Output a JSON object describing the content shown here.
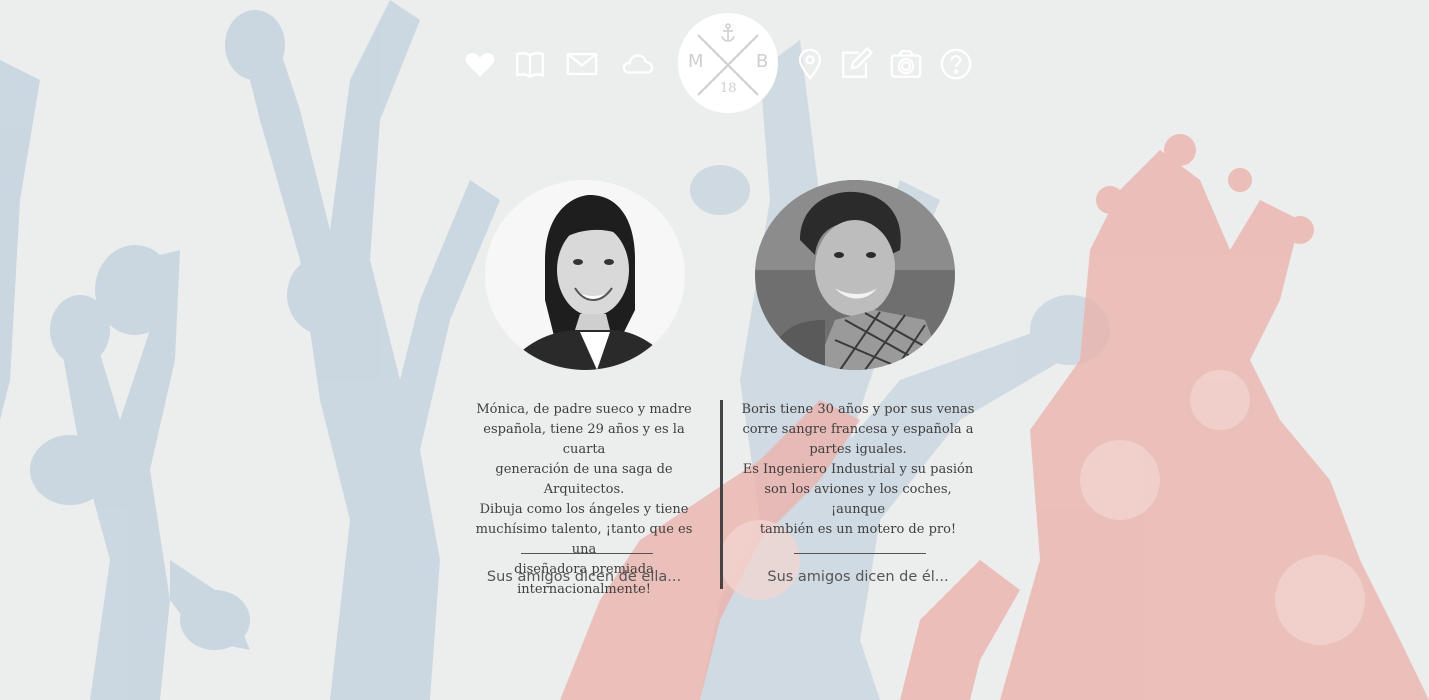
{
  "logo": {
    "letter_left": "M",
    "letter_right": "B",
    "number": "18",
    "icon": "anchor-icon"
  },
  "nav": {
    "left_icons": [
      "heart-icon",
      "book-icon",
      "envelope-icon",
      "cloud-icon"
    ],
    "right_icons": [
      "location-pin-icon",
      "edit-icon",
      "camera-icon",
      "question-icon"
    ]
  },
  "people": {
    "left": {
      "photo": "woman-portrait",
      "bio": "Mónica, de padre sueco y madre\nespañola, tiene 29 años y es la cuarta\ngeneración de una saga de Arquitectos.\nDibuja como los ángeles y tiene\nmuchísimo talento, ¡tanto que es una\ndiseñadora premiada\ninternacionalmente!",
      "friends_link": "Sus amigos dicen de ella..."
    },
    "right": {
      "photo": "man-portrait",
      "bio": "Boris tiene 30 años y por sus venas\ncorre sangre francesa y española a\npartes iguales.\nEs Ingeniero Industrial y su pasión\nson los aviones y los coches, ¡aunque\ntambién es un motero de pro!",
      "friends_link": "Sus amigos dicen de él..."
    }
  },
  "colors": {
    "background": "#eceeee",
    "coral_blue": "#b9c9d6",
    "coral_red": "#e7a8a3",
    "text": "#3e3e3e"
  }
}
